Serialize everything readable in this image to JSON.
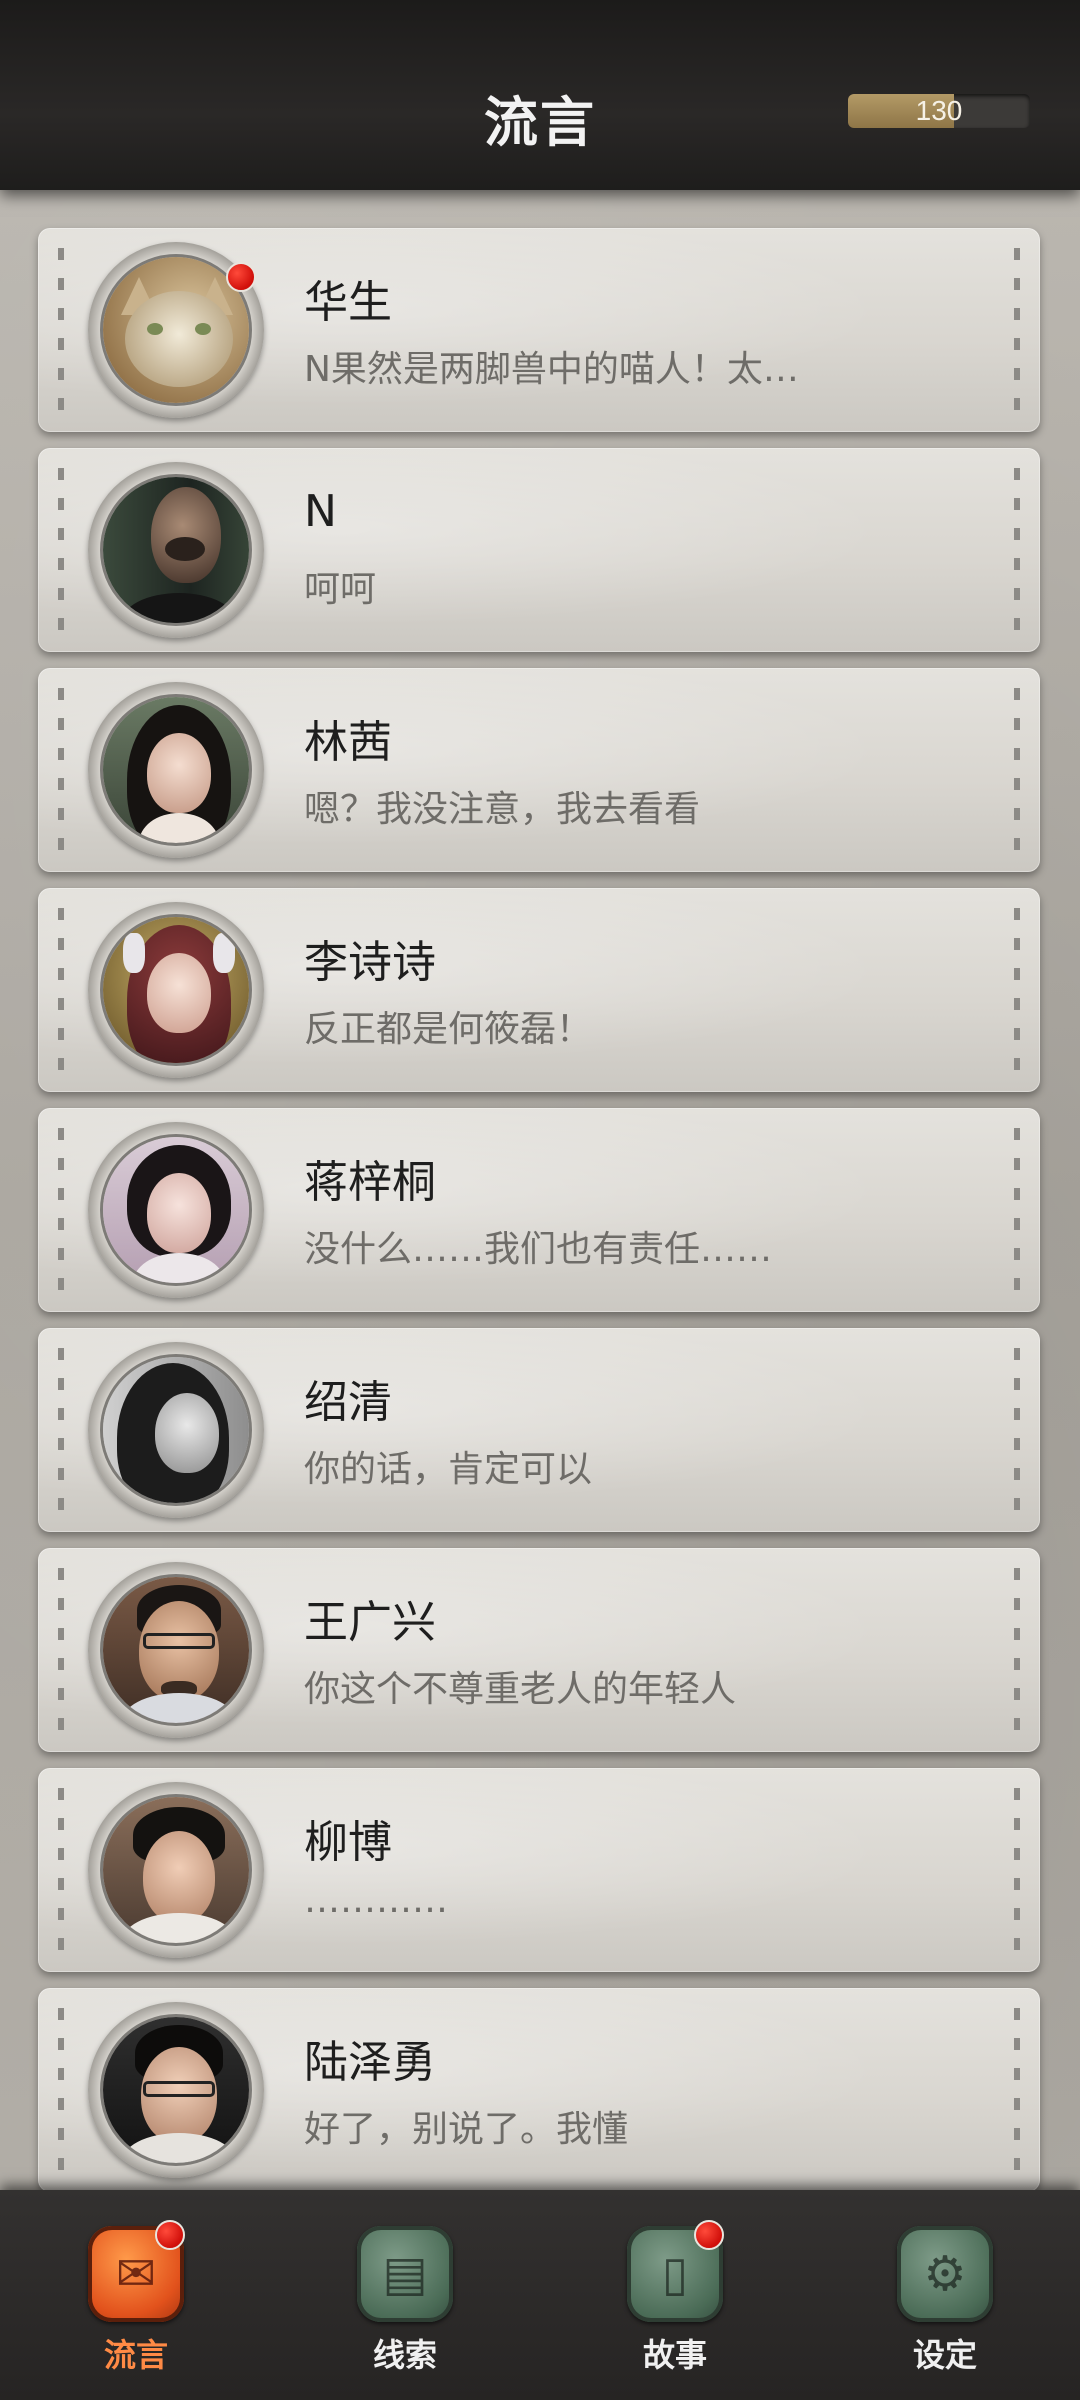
{
  "header": {
    "title": "流言",
    "counter_value": "130",
    "counter_fill_fraction": 0.58
  },
  "contacts": [
    {
      "name": "华生",
      "message": "N果然是两脚兽中的喵人！太…",
      "unread": true,
      "avatar": "cat-avatar"
    },
    {
      "name": "N",
      "message": "呵呵",
      "unread": false,
      "avatar": "man-dark-avatar"
    },
    {
      "name": "林茜",
      "message": "嗯？我没注意，我去看看",
      "unread": false,
      "avatar": "woman-long-hair-avatar"
    },
    {
      "name": "李诗诗",
      "message": "反正都是何筱磊！",
      "unread": false,
      "avatar": "woman-red-hair-avatar"
    },
    {
      "name": "蒋梓桐",
      "message": "没什么……我们也有责任……",
      "unread": false,
      "avatar": "woman-bob-avatar"
    },
    {
      "name": "绍清",
      "message": "你的话，肯定可以",
      "unread": false,
      "avatar": "woman-grayscale-avatar"
    },
    {
      "name": "王广兴",
      "message": "你这个不尊重老人的年轻人",
      "unread": false,
      "avatar": "man-glasses-beard-avatar"
    },
    {
      "name": "柳博",
      "message": "…………",
      "unread": false,
      "avatar": "man-short-hair-avatar"
    },
    {
      "name": "陆泽勇",
      "message": "好了，别说了。我懂",
      "unread": false,
      "avatar": "man-glasses-avatar"
    }
  ],
  "nav": [
    {
      "label": "流言",
      "icon": "chat-bubble-icon",
      "active": true,
      "badge": true
    },
    {
      "label": "线索",
      "icon": "document-icon",
      "active": false,
      "badge": false
    },
    {
      "label": "故事",
      "icon": "book-icon",
      "active": false,
      "badge": true
    },
    {
      "label": "设定",
      "icon": "gear-icon",
      "active": false,
      "badge": false
    }
  ],
  "colors": {
    "badge_red": "#d00f0a",
    "active_tab": "#ff8a45",
    "inactive_icon": "#4a6b56"
  }
}
